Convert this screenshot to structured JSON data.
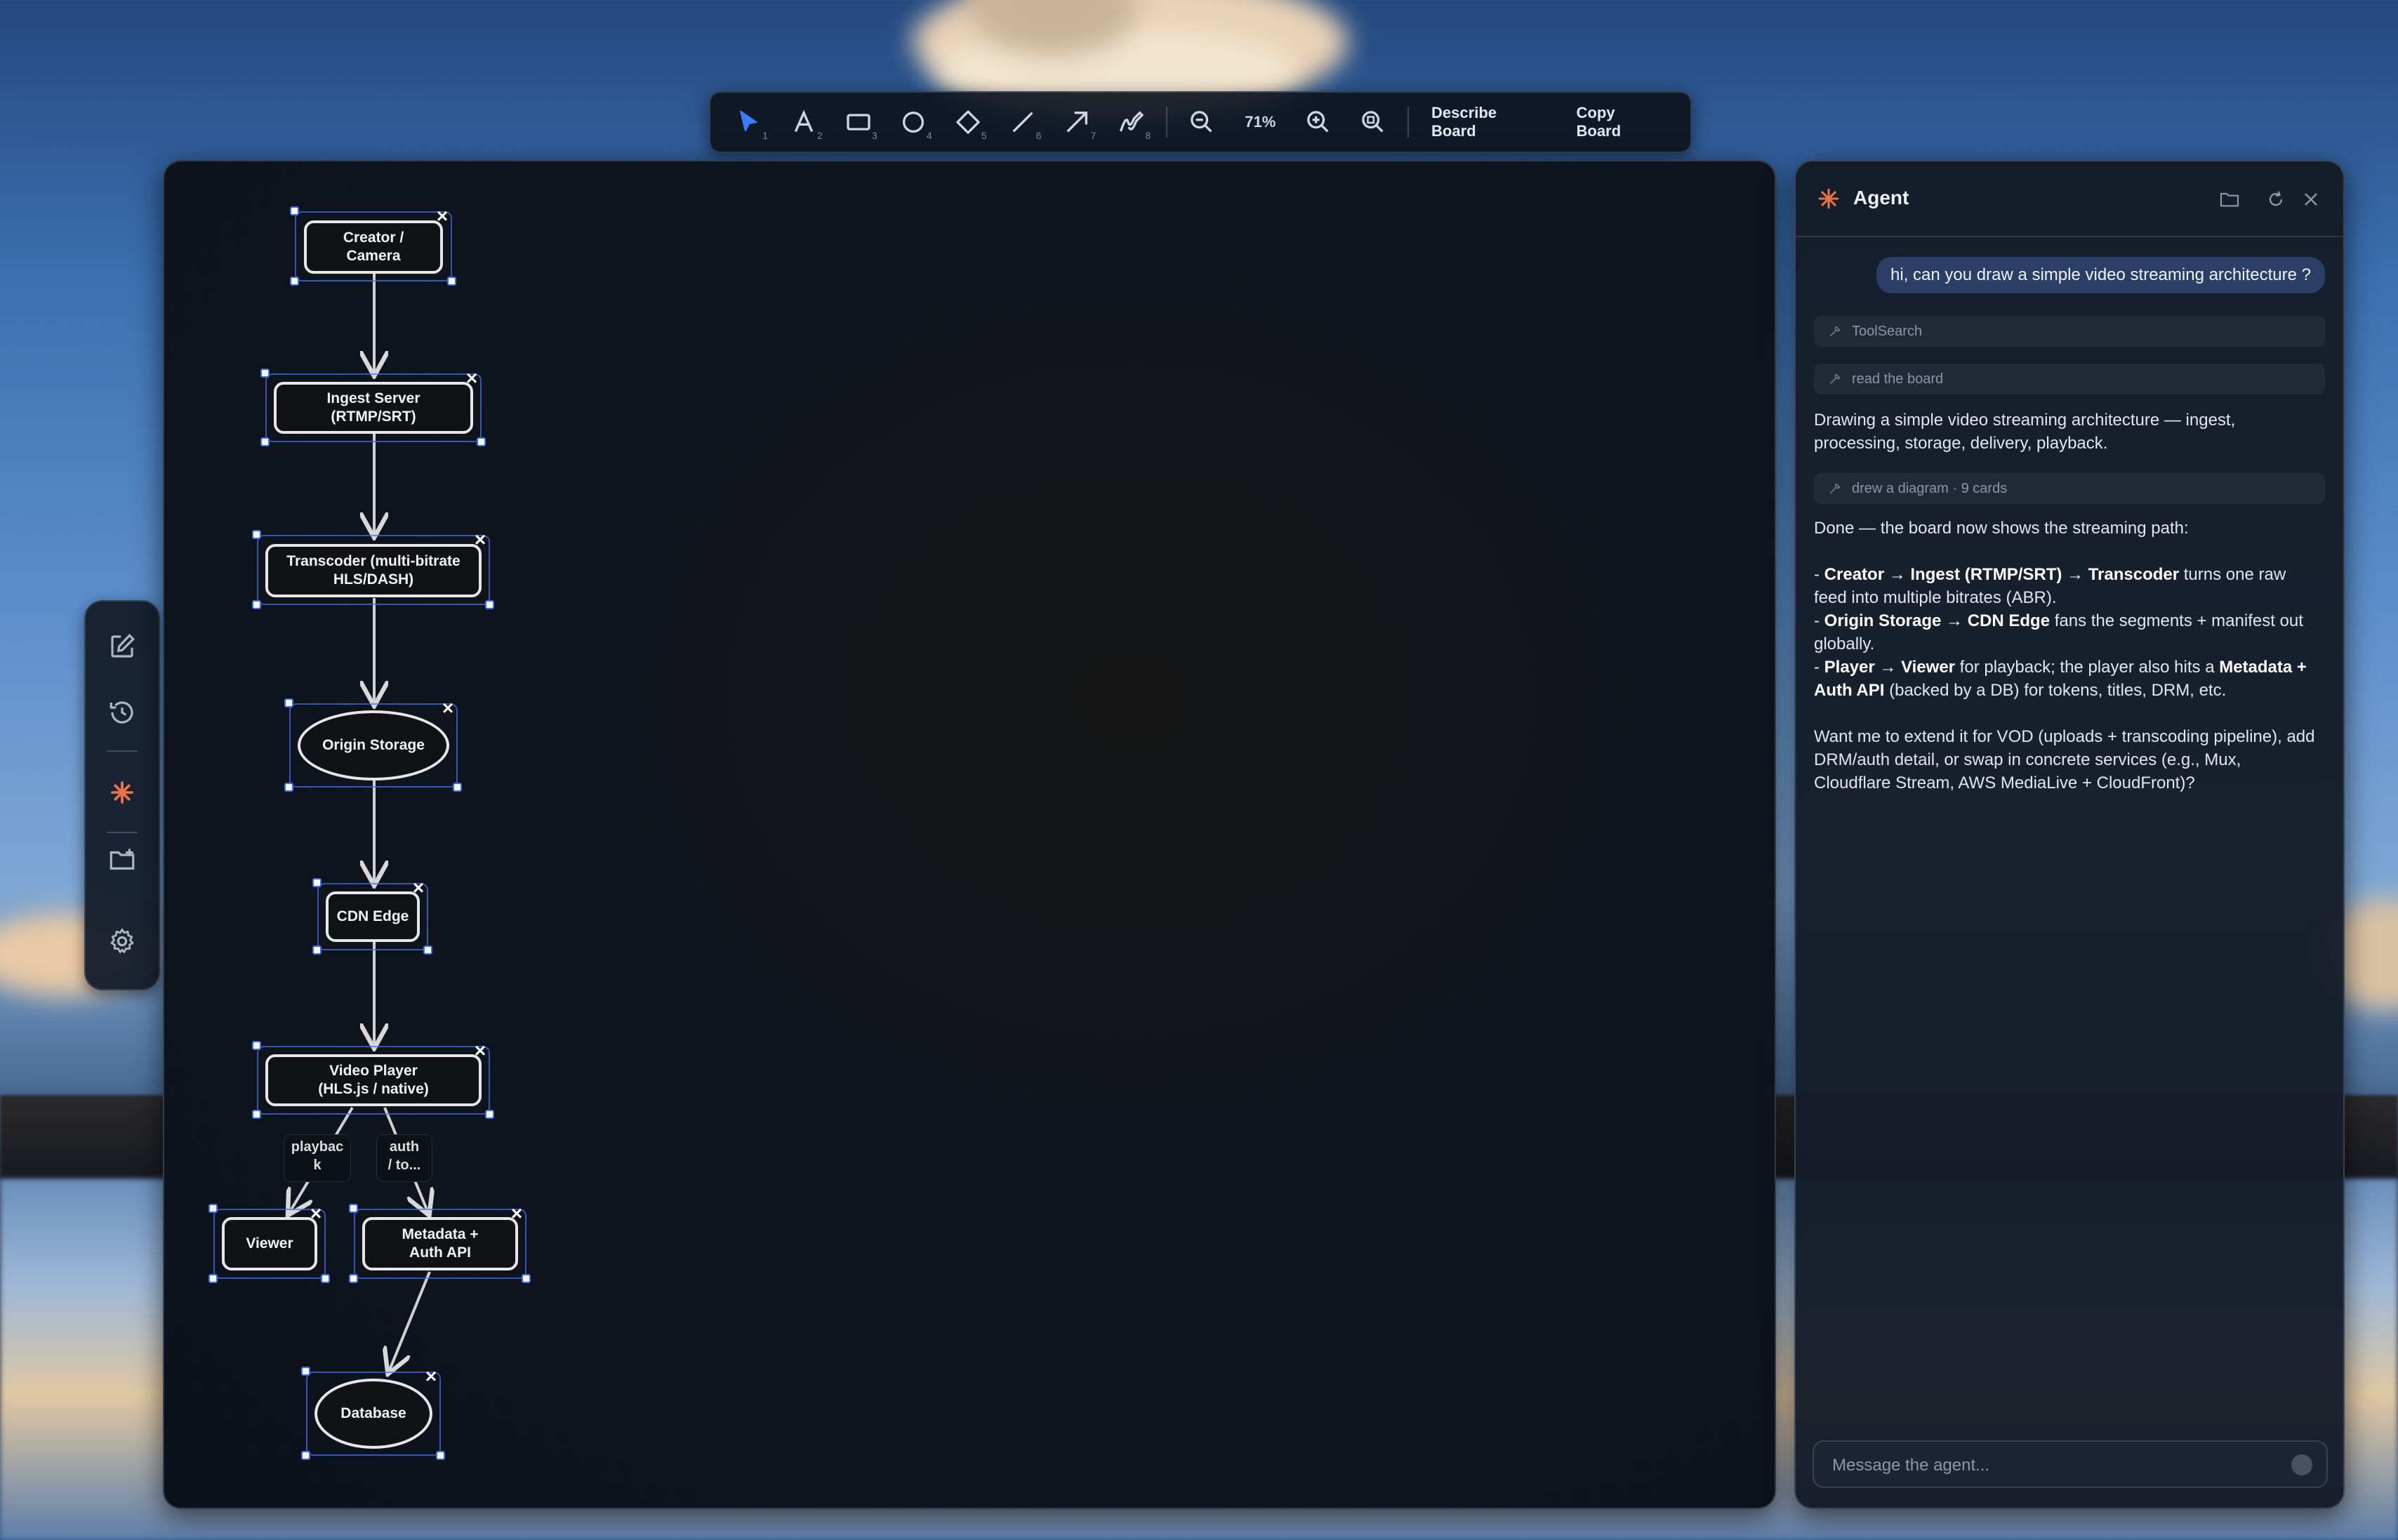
{
  "toolbar": {
    "tools": [
      {
        "name": "select",
        "shortcut": "1"
      },
      {
        "name": "text",
        "shortcut": "2"
      },
      {
        "name": "rectangle",
        "shortcut": "3"
      },
      {
        "name": "ellipse",
        "shortcut": "4"
      },
      {
        "name": "diamond",
        "shortcut": "5"
      },
      {
        "name": "line",
        "shortcut": "6"
      },
      {
        "name": "arrow",
        "shortcut": "7"
      },
      {
        "name": "draw",
        "shortcut": "8"
      }
    ],
    "zoom": "71%",
    "describe_label": "Describe Board",
    "copy_label": "Copy Board"
  },
  "board": {
    "nodes": {
      "creator": "Creator /\nCamera",
      "ingest": "Ingest Server\n(RTMP/SRT)",
      "transcoder": "Transcoder (multi-bitrate\nHLS/DASH)",
      "origin": "Origin Storage",
      "cdn": "CDN Edge",
      "player": "Video Player\n(HLS.js / native)",
      "viewer": "Viewer",
      "metadata": "Metadata +\nAuth API",
      "database": "Database"
    },
    "edge_labels": {
      "playback": "playbac\nk",
      "auth": "auth\n/ to..."
    }
  },
  "agent": {
    "title": "Agent",
    "user_message": "hi, can you draw a simple video streaming architecture ?",
    "tool_calls": [
      "ToolSearch",
      "read the board",
      "drew a diagram · 9 cards"
    ],
    "msg1": "Drawing a simple video streaming architecture — ingest, processing, storage, delivery, playback.",
    "msg2": {
      "intro": "Done — the board now shows the streaming path:",
      "l1_a": "Creator → Ingest (RTMP/SRT) → Transcoder",
      "l1_b": " turns one raw feed into multiple bitrates (ABR).",
      "l2_a": "Origin Storage → CDN Edge",
      "l2_b": " fans the segments + manifest out globally.",
      "l3_a": "Player → Viewer",
      "l3_b": " for playback; the player also hits a ",
      "l3_c": "Metadata + Auth API",
      "l3_d": " (backed by a DB) for tokens, titles, DRM, etc.",
      "outro": "Want me to extend it for VOD (uploads + transcoding pipeline), add DRM/auth detail, or swap in concrete services (e.g., Mux, Cloudflare Stream, AWS MediaLive + CloudFront)?"
    },
    "input_placeholder": "Message the agent..."
  },
  "colors": {
    "accent": "#3d7cff",
    "selection": "#3d6ee0",
    "agent_logo": "#e8734a"
  }
}
